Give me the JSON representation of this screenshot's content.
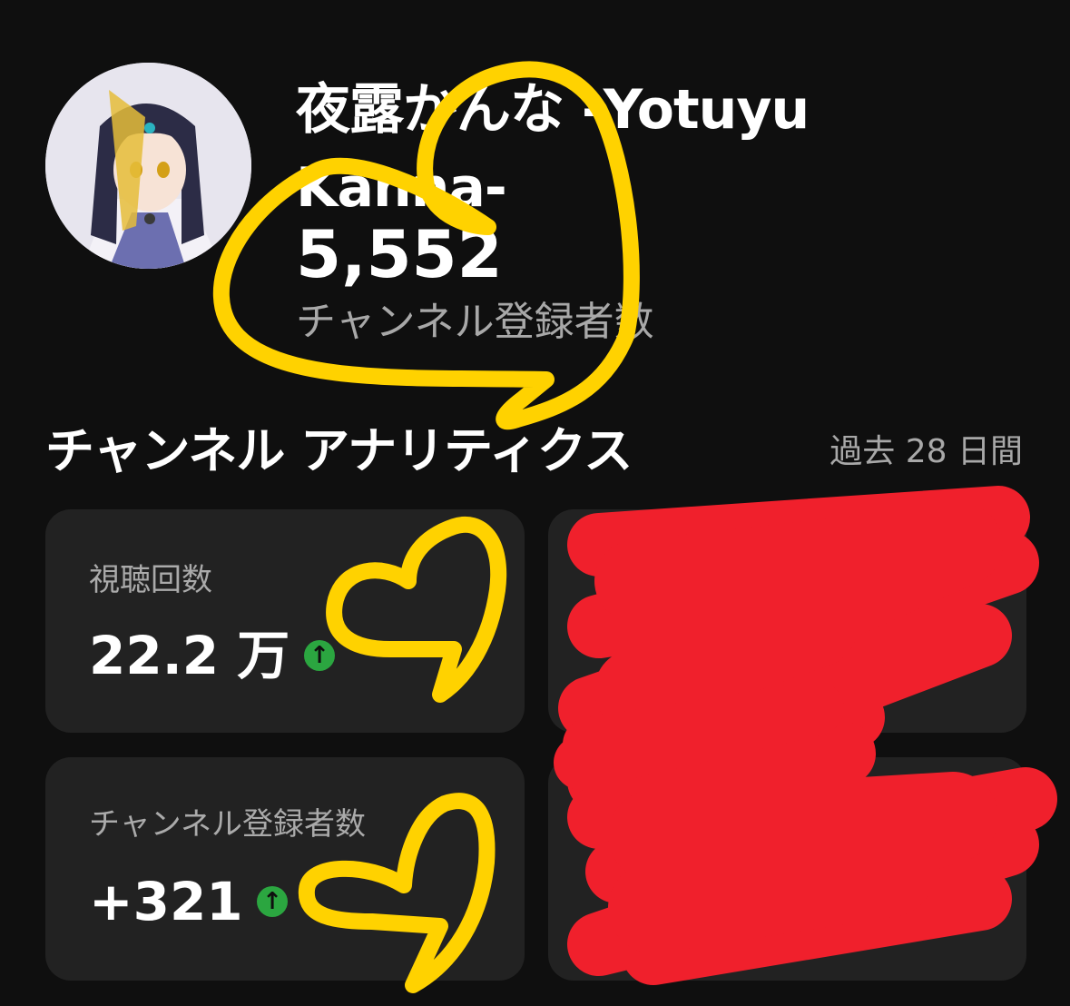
{
  "channel": {
    "name": "夜露かんな -Yotuyu Kanna-",
    "subscriber_count": "5,552",
    "subscriber_label": "チャンネル登録者数"
  },
  "analytics": {
    "title": "チャンネル アナリティクス",
    "period": "過去 28 日間",
    "cards": [
      {
        "label": "視聴回数",
        "value": "22.2 万",
        "trend": "up",
        "trend_icon": "arrow-up-icon"
      },
      {
        "label": "チャンネル登録者数",
        "value": "+321",
        "trend": "up",
        "trend_icon": "arrow-up-icon"
      }
    ]
  },
  "colors": {
    "background": "#0f0f0f",
    "card": "#222222",
    "secondary_text": "#aaaaaa",
    "trend_up": "#2ba640",
    "heart_marker": "#ffd200",
    "redaction_marker": "#f0202c"
  }
}
